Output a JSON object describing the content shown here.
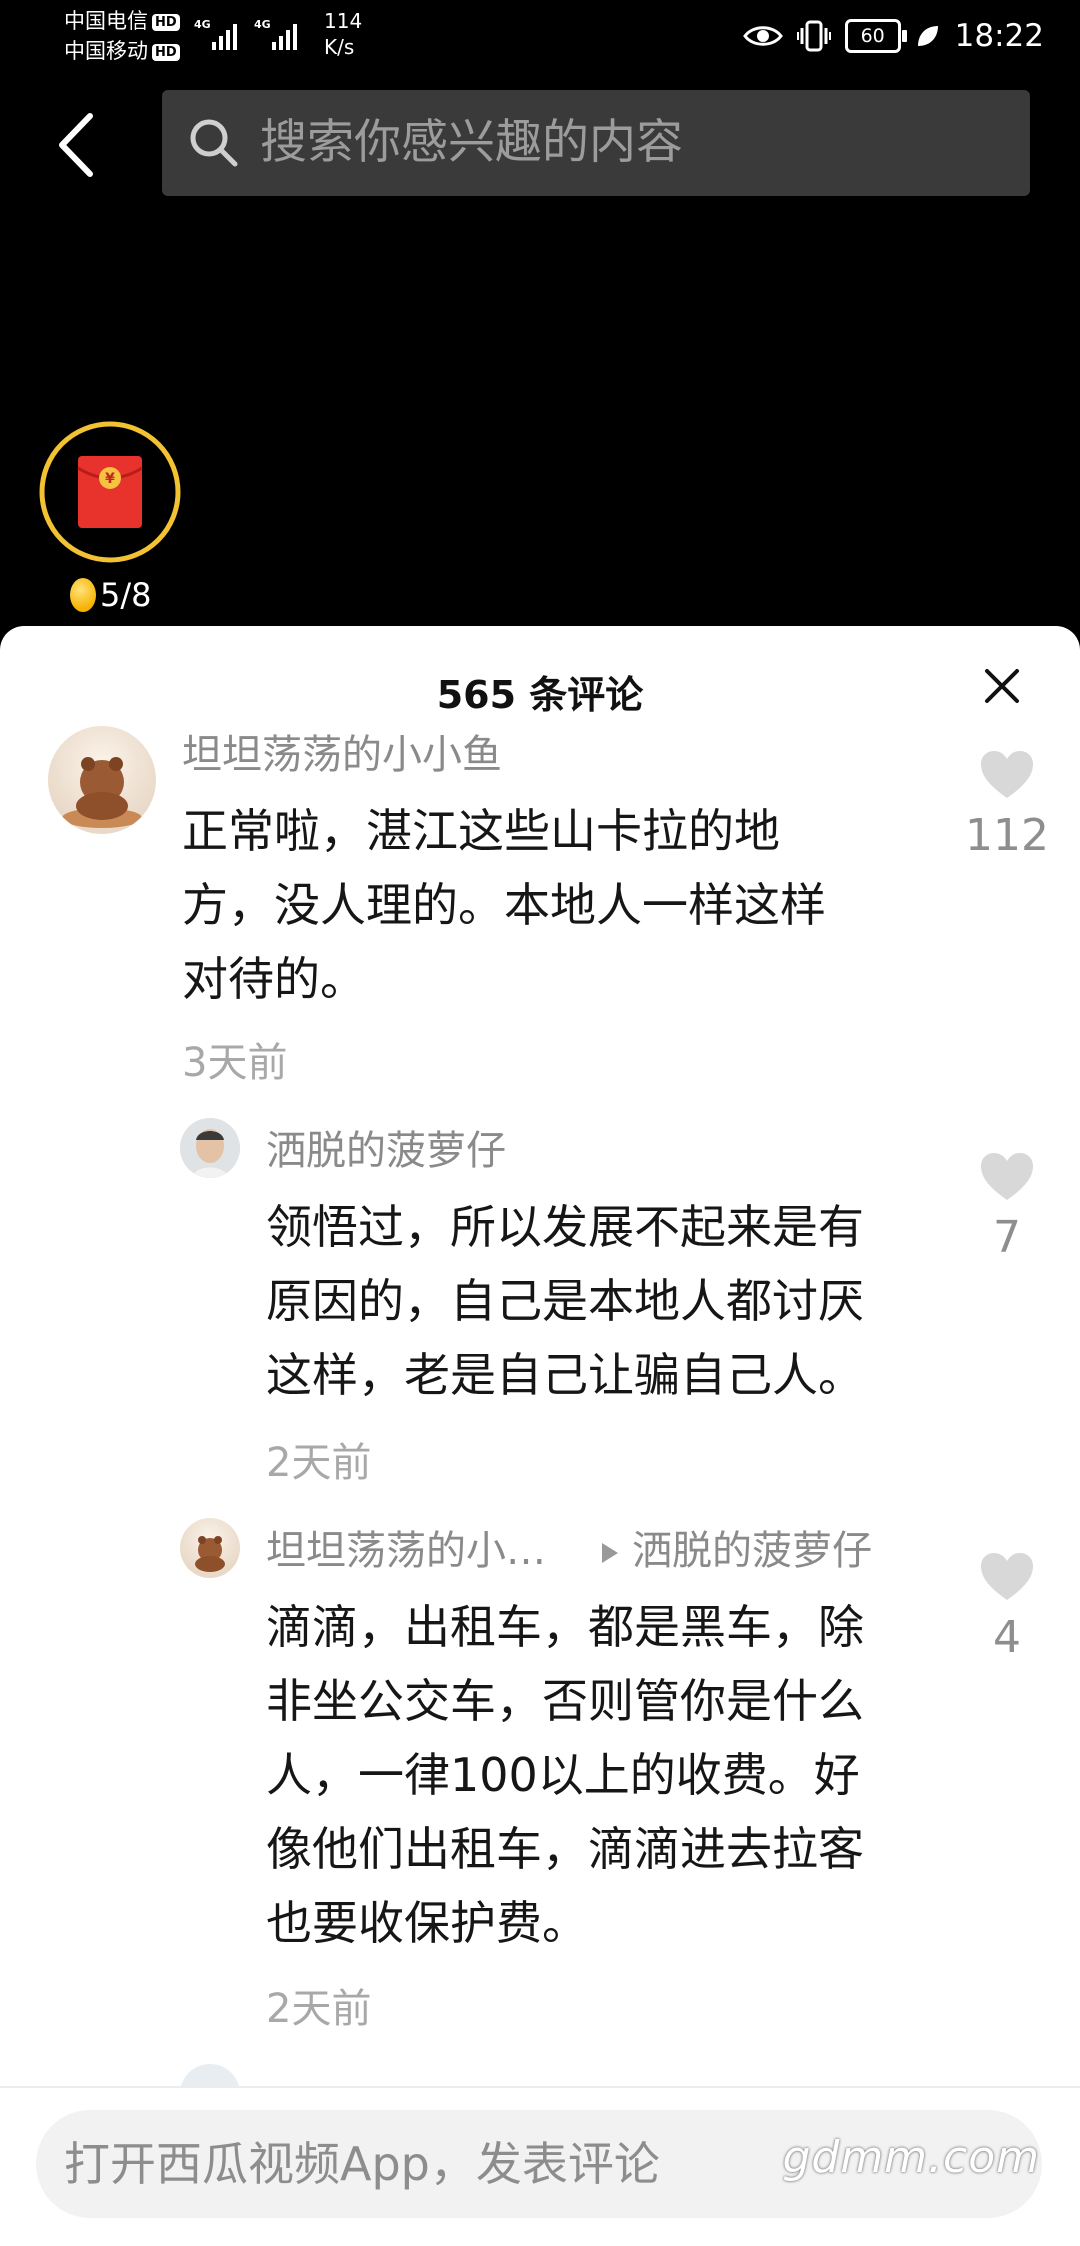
{
  "status_bar": {
    "carrier_1": "中国电信",
    "carrier_2": "中国移动",
    "hd_badge": "HD",
    "network": "4G",
    "speed_value": "114",
    "speed_unit": "K/s",
    "battery": "60",
    "time": "18:22"
  },
  "search": {
    "placeholder": "搜索你感兴趣的内容"
  },
  "red_packet": {
    "progress": "5/8",
    "ring_color": "#f2c232"
  },
  "comments_panel": {
    "title": "565 条评论",
    "comments": [
      {
        "username": "坦坦荡荡的小小鱼",
        "lines": [
          "正常啦，湛江这些山卡拉的地",
          "方，没人理的。本地人一样这样",
          "对待的。"
        ],
        "time": "3天前",
        "likes": "112"
      },
      {
        "username": "洒脱的菠萝仔",
        "lines": [
          "领悟过，所以发展不起来是有",
          "原因的，自己是本地人都讨厌",
          "这样，老是自己让骗自己人。"
        ],
        "time": "2天前",
        "likes": "7"
      },
      {
        "username": "坦坦荡荡的小…",
        "reply_to": "洒脱的菠萝仔",
        "lines": [
          "滴滴，出租车，都是黑车，除",
          "非坐公交车，否则管你是什么",
          "人，一律100以上的收费。好",
          "像他们出租车，滴滴进去拉客",
          "也要收保护费。"
        ],
        "time": "2天前",
        "likes": "4"
      }
    ]
  },
  "bottom_bar": {
    "input_placeholder": "打开西瓜视频App，发表评论",
    "watermark": "gdmm.com"
  }
}
